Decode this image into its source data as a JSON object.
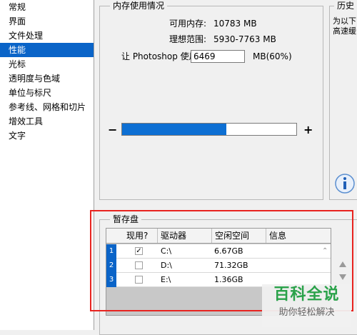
{
  "sidebar": {
    "items": [
      {
        "label": "常规"
      },
      {
        "label": "界面"
      },
      {
        "label": "文件处理"
      },
      {
        "label": "性能",
        "selected": true
      },
      {
        "label": "光标"
      },
      {
        "label": "透明度与色域"
      },
      {
        "label": "单位与标尺"
      },
      {
        "label": "参考线、网格和切片"
      },
      {
        "label": "增效工具"
      },
      {
        "label": "文字"
      }
    ]
  },
  "memory": {
    "title": "内存使用情况",
    "available_label": "可用内存:",
    "available_value": "10783 MB",
    "ideal_label": "理想范围:",
    "ideal_value": "5930-7763 MB",
    "let_label": "让 Photoshop 使用(L):",
    "let_value": "6469",
    "unit_label": "MB(60%)",
    "minus": "−",
    "plus": "+",
    "usage_fraction": 0.6
  },
  "history": {
    "title": "历史",
    "line1": "为以下",
    "line2": "高速缓"
  },
  "scratch": {
    "title": "暂存盘",
    "columns": [
      "现用?",
      "驱动器",
      "空闲空间",
      "信息"
    ],
    "rows": [
      {
        "num": "1",
        "checked": true,
        "drive": "C:\\",
        "free": "6.67GB",
        "info": ""
      },
      {
        "num": "2",
        "checked": false,
        "drive": "D:\\",
        "free": "71.32GB",
        "info": ""
      },
      {
        "num": "3",
        "checked": false,
        "drive": "E:\\",
        "free": "1.36GB",
        "info": ""
      }
    ]
  },
  "watermark": {
    "title": "百科全说",
    "subtitle": "助你轻松解决"
  },
  "colors": {
    "selection": "#0a64c8",
    "slider_fill": "#0d6fd3",
    "highlight": "#e8231f",
    "watermark_green": "#2aa24a"
  },
  "icons": {
    "info": "info-icon",
    "scroll_up": "scroll-up-arrow-icon",
    "scroll_down": "scroll-down-arrow-icon"
  }
}
